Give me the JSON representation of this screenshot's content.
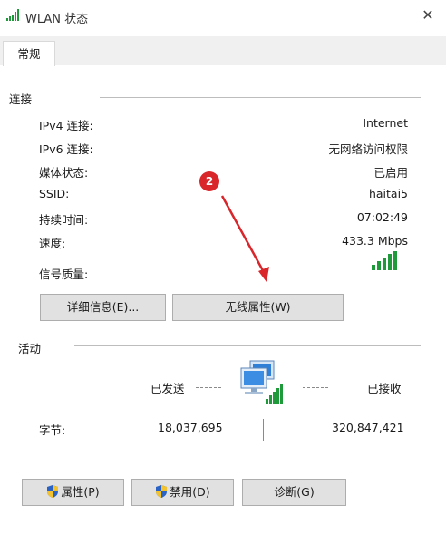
{
  "window": {
    "title": "WLAN 状态",
    "close_glyph": "✕",
    "icon": "wifi-signal-icon"
  },
  "tabs": [
    {
      "label": "常规"
    }
  ],
  "connection": {
    "section_title": "连接",
    "rows": [
      {
        "label": "IPv4 连接:",
        "value": "Internet"
      },
      {
        "label": "IPv6 连接:",
        "value": "无网络访问权限"
      },
      {
        "label": "媒体状态:",
        "value": "已启用"
      },
      {
        "label": "SSID:",
        "value": "haitai5"
      },
      {
        "label": "持续时间:",
        "value": "07:02:49"
      },
      {
        "label": "速度:",
        "value": "433.3 Mbps"
      },
      {
        "label": "信号质量:",
        "value": ""
      }
    ],
    "signal_icon": "signal-bars-icon",
    "buttons": {
      "details": "详细信息(E)...",
      "wireless_properties": "无线属性(W)"
    }
  },
  "annotation": {
    "badge_number": "2",
    "color": "#d8262b"
  },
  "activity": {
    "section_title": "活动",
    "sent_label": "已发送",
    "received_label": "已接收",
    "bytes_label": "字节:",
    "bytes_sent": "18,037,695",
    "bytes_received": "320,847,421",
    "icon": "network-computer-icon"
  },
  "footer_buttons": {
    "properties": "属性(P)",
    "disable": "禁用(D)",
    "diagnose": "诊断(G)"
  },
  "colors": {
    "signal_green": "#1f9a3a",
    "button_face": "#e1e1e1",
    "badge_red": "#d8262b"
  }
}
